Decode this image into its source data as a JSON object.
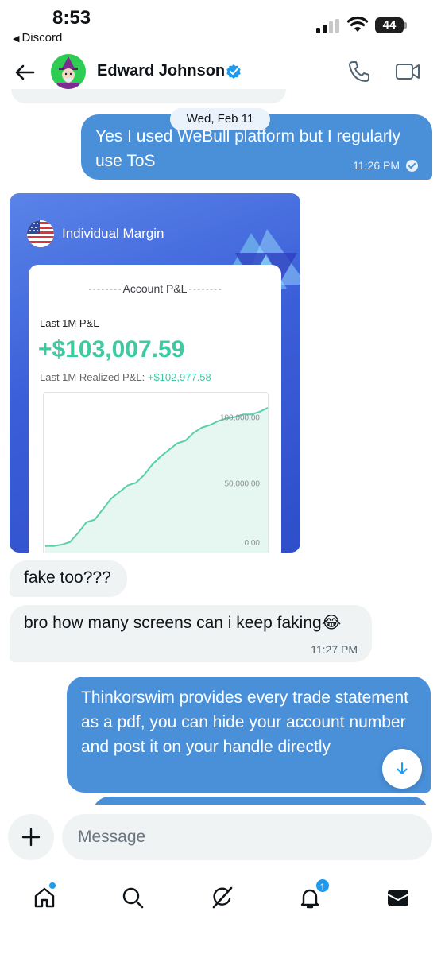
{
  "status_bar": {
    "time": "8:53",
    "back_app": "Discord",
    "battery": "44",
    "icons": [
      "signal-icon",
      "wifi-icon",
      "battery-icon"
    ]
  },
  "header": {
    "contact_name": "Edward Johnson",
    "verified": true,
    "icons": [
      "back-arrow-icon",
      "verified-badge-icon",
      "phone-icon",
      "video-icon"
    ]
  },
  "chat": {
    "date_separator": "Wed, Feb 11",
    "messages": [
      {
        "direction": "outgoing",
        "text": "Yes I used WeBull platform but I regularly use ToS",
        "time": "11:26 PM",
        "read": true
      },
      {
        "direction": "incoming",
        "type": "image"
      },
      {
        "direction": "incoming",
        "text": "fake too???"
      },
      {
        "direction": "incoming",
        "text": "bro how many screens can i keep faking😂",
        "time": "11:27 PM"
      },
      {
        "direction": "outgoing",
        "text": "Thinkorswim provides every trade statement as a pdf, you can hide your account number and post it on your handle directly"
      }
    ]
  },
  "image_card": {
    "account_type": "Individual Margin",
    "section_title": "Account P&L",
    "period_label": "Last 1M P&L",
    "pl_value": "+$103,007.59",
    "realized_label": "Last 1M Realized P&L:",
    "realized_value": "+$102,977.58",
    "accent_color": "#3ec9a0"
  },
  "chart_data": {
    "type": "area",
    "title": "",
    "xlabel": "",
    "ylabel": "",
    "ylim": [
      0,
      110000
    ],
    "yticks": [
      "100,000.00",
      "50,000.00",
      "0.00"
    ],
    "ytick_values": [
      100000,
      50000,
      0
    ],
    "grid": false,
    "series": [
      {
        "values": [
          2000,
          2000,
          3000,
          5000,
          12000,
          20000,
          22000,
          30000,
          38000,
          43000,
          48000,
          50000,
          56000,
          64000,
          70000,
          75000,
          80000,
          82000,
          88000,
          92000,
          94000,
          97000,
          99000,
          100000,
          102000,
          102000,
          104000,
          107000
        ]
      }
    ]
  },
  "composer": {
    "placeholder": "Message"
  },
  "nav": {
    "items": [
      "home",
      "search",
      "grok",
      "notifications",
      "messages"
    ],
    "notification_count": "1"
  },
  "colors": {
    "outgoing_bubble": "#4a90d9",
    "incoming_bubble": "#eff3f4",
    "accent": "#1d9bf0"
  }
}
